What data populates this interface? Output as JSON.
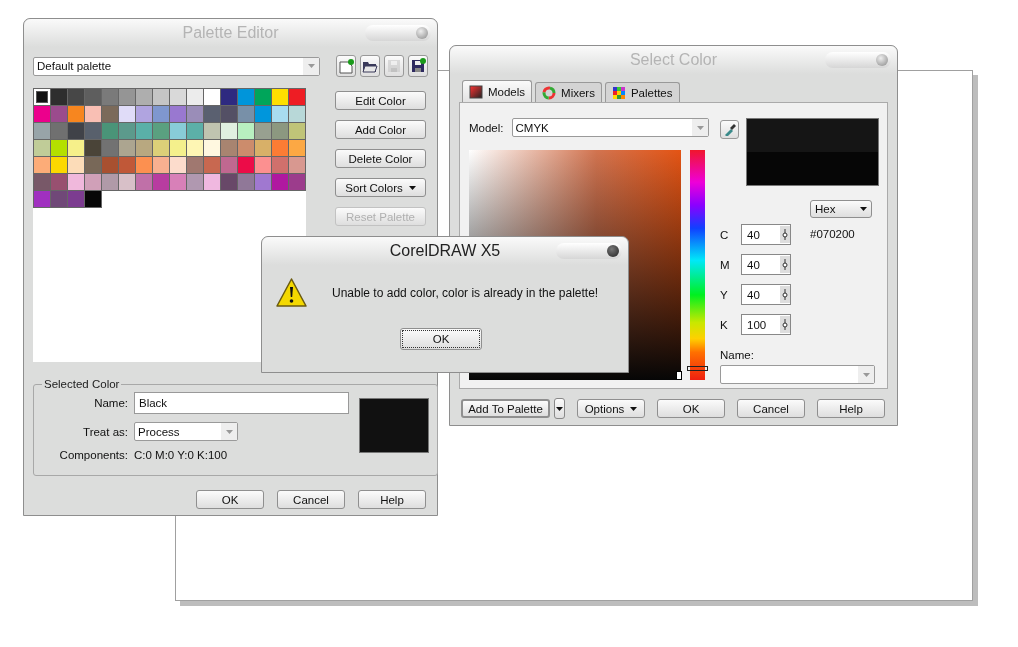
{
  "palette_editor": {
    "title": "Palette Editor",
    "palette_name": "Default palette",
    "tool_buttons": [
      {
        "kind": "new",
        "disabled": false
      },
      {
        "kind": "open",
        "disabled": false
      },
      {
        "kind": "save",
        "disabled": true
      },
      {
        "kind": "save_as",
        "disabled": false
      }
    ],
    "swatches": [
      {
        "color": "#111111",
        "selected": true
      },
      {
        "color": "#2e2e2e",
        "selected": false
      },
      {
        "color": "#474747",
        "selected": false
      },
      {
        "color": "#5e5e5e",
        "selected": false
      },
      {
        "color": "#7a7a7a",
        "selected": false
      },
      {
        "color": "#959595",
        "selected": false
      },
      {
        "color": "#aeaeae",
        "selected": false
      },
      {
        "color": "#c5c5c5",
        "selected": false
      },
      {
        "color": "#d9d9d9",
        "selected": false
      },
      {
        "color": "#ececec",
        "selected": false
      },
      {
        "color": "#ffffff",
        "selected": false
      },
      {
        "color": "#2e2a80",
        "selected": false
      },
      {
        "color": "#0095da",
        "selected": false
      },
      {
        "color": "#00a55a",
        "selected": false
      },
      {
        "color": "#ffdf00",
        "selected": false
      },
      {
        "color": "#ee1d24",
        "selected": false
      },
      {
        "color": "#ec008c",
        "selected": false
      },
      {
        "color": "#9b4b8d",
        "selected": false
      },
      {
        "color": "#f7861f",
        "selected": false
      },
      {
        "color": "#f9bfb4",
        "selected": false
      },
      {
        "color": "#7b6a5a",
        "selected": false
      },
      {
        "color": "#e0dcf8",
        "selected": false
      },
      {
        "color": "#b0a4e0",
        "selected": false
      },
      {
        "color": "#7f97cf",
        "selected": false
      },
      {
        "color": "#9978d0",
        "selected": false
      },
      {
        "color": "#9a8db8",
        "selected": false
      },
      {
        "color": "#5a6070",
        "selected": false
      },
      {
        "color": "#545065",
        "selected": false
      },
      {
        "color": "#7890a8",
        "selected": false
      },
      {
        "color": "#0096dc",
        "selected": false
      },
      {
        "color": "#a8dcf0",
        "selected": false
      },
      {
        "color": "#b8d8d8",
        "selected": false
      },
      {
        "color": "#98a4a8",
        "selected": false
      },
      {
        "color": "#707070",
        "selected": false
      },
      {
        "color": "#404248",
        "selected": false
      },
      {
        "color": "#58606c",
        "selected": false
      },
      {
        "color": "#4a9478",
        "selected": false
      },
      {
        "color": "#5c9a8c",
        "selected": false
      },
      {
        "color": "#5ab0a8",
        "selected": false
      },
      {
        "color": "#5aa080",
        "selected": false
      },
      {
        "color": "#88ccd8",
        "selected": false
      },
      {
        "color": "#5cb0a8",
        "selected": false
      },
      {
        "color": "#c0c4b0",
        "selected": false
      },
      {
        "color": "#e0f0e0",
        "selected": false
      },
      {
        "color": "#b8f0c0",
        "selected": false
      },
      {
        "color": "#98a090",
        "selected": false
      },
      {
        "color": "#8c9880",
        "selected": false
      },
      {
        "color": "#c0c478",
        "selected": false
      },
      {
        "color": "#c0cc98",
        "selected": false
      },
      {
        "color": "#b4e000",
        "selected": false
      },
      {
        "color": "#f6f08a",
        "selected": false
      },
      {
        "color": "#4a4438",
        "selected": false
      },
      {
        "color": "#727272",
        "selected": false
      },
      {
        "color": "#aca590",
        "selected": false
      },
      {
        "color": "#b8a880",
        "selected": false
      },
      {
        "color": "#dcd078",
        "selected": false
      },
      {
        "color": "#f4f08c",
        "selected": false
      },
      {
        "color": "#fef6b4",
        "selected": false
      },
      {
        "color": "#fff8e0",
        "selected": false
      },
      {
        "color": "#a88470",
        "selected": false
      },
      {
        "color": "#cc8c6c",
        "selected": false
      },
      {
        "color": "#d8b068",
        "selected": false
      },
      {
        "color": "#fc7c34",
        "selected": false
      },
      {
        "color": "#fca844",
        "selected": false
      },
      {
        "color": "#fcac78",
        "selected": false
      },
      {
        "color": "#fcd800",
        "selected": false
      },
      {
        "color": "#fcdcb8",
        "selected": false
      },
      {
        "color": "#786858",
        "selected": false
      },
      {
        "color": "#a85030",
        "selected": false
      },
      {
        "color": "#c05838",
        "selected": false
      },
      {
        "color": "#fc9050",
        "selected": false
      },
      {
        "color": "#f8b090",
        "selected": false
      },
      {
        "color": "#fcdccc",
        "selected": false
      },
      {
        "color": "#a07870",
        "selected": false
      },
      {
        "color": "#c86850",
        "selected": false
      },
      {
        "color": "#c06890",
        "selected": false
      },
      {
        "color": "#ec0c48",
        "selected": false
      },
      {
        "color": "#fc9090",
        "selected": false
      },
      {
        "color": "#d0706c",
        "selected": false
      },
      {
        "color": "#d89890",
        "selected": false
      },
      {
        "color": "#785868",
        "selected": false
      },
      {
        "color": "#985070",
        "selected": false
      },
      {
        "color": "#f0b8dc",
        "selected": false
      },
      {
        "color": "#d0a0b8",
        "selected": false
      },
      {
        "color": "#b09aa8",
        "selected": false
      },
      {
        "color": "#d8c0c8",
        "selected": false
      },
      {
        "color": "#c070a8",
        "selected": false
      },
      {
        "color": "#b83ca0",
        "selected": false
      },
      {
        "color": "#d880b8",
        "selected": false
      },
      {
        "color": "#b098b0",
        "selected": false
      },
      {
        "color": "#f0b8e0",
        "selected": false
      },
      {
        "color": "#684868",
        "selected": false
      },
      {
        "color": "#907898",
        "selected": false
      },
      {
        "color": "#a078d0",
        "selected": false
      },
      {
        "color": "#b018a0",
        "selected": false
      },
      {
        "color": "#9c3c8c",
        "selected": false
      },
      {
        "color": "#a030c0",
        "selected": false
      },
      {
        "color": "#704878",
        "selected": false
      },
      {
        "color": "#7c3c90",
        "selected": false
      },
      {
        "color": "#070707",
        "selected": false
      }
    ],
    "buttons": [
      {
        "label": "Edit Color",
        "kind": "plain",
        "disabled": false
      },
      {
        "label": "Add Color",
        "kind": "plain",
        "disabled": false
      },
      {
        "label": "Delete Color",
        "kind": "plain",
        "disabled": false
      },
      {
        "label": "Sort Colors",
        "kind": "menu",
        "disabled": false
      },
      {
        "label": "Reset Palette",
        "kind": "plain",
        "disabled": true
      }
    ],
    "selected_color": {
      "group_label": "Selected Color",
      "name_label": "Name:",
      "name": "Black",
      "treat_label": "Treat as:",
      "treat_as": "Process",
      "components_label": "Components:",
      "components": "C:0 M:0 Y:0 K:100",
      "color": "#111111"
    },
    "footer_buttons": [
      "OK",
      "Cancel",
      "Help"
    ]
  },
  "select_color": {
    "title": "Select Color",
    "tabs": [
      {
        "label": "Models",
        "kind": "models",
        "selected": true
      },
      {
        "label": "Mixers",
        "kind": "mixers",
        "selected": false
      },
      {
        "label": "Palettes",
        "kind": "palettes",
        "selected": false
      }
    ],
    "model_label": "Model:",
    "model": "CMYK",
    "hue": {
      "level": 0.05
    },
    "format": "Hex",
    "hex_value": "#070200",
    "components": [
      {
        "label": "C",
        "value": "40"
      },
      {
        "label": "M",
        "value": "40"
      },
      {
        "label": "Y",
        "value": "40"
      },
      {
        "label": "K",
        "value": "100"
      }
    ],
    "name_label": "Name:",
    "footer_buttons": [
      {
        "label": "Add To Palette",
        "kind": "split"
      },
      {
        "label": "Options",
        "kind": "menu"
      },
      {
        "label": "OK",
        "kind": "plain"
      },
      {
        "label": "Cancel",
        "kind": "plain"
      },
      {
        "label": "Help",
        "kind": "plain"
      }
    ]
  },
  "alert": {
    "title": "CorelDRAW X5",
    "message": "Unable to add color, color is already in the palette!",
    "button": "OK"
  }
}
